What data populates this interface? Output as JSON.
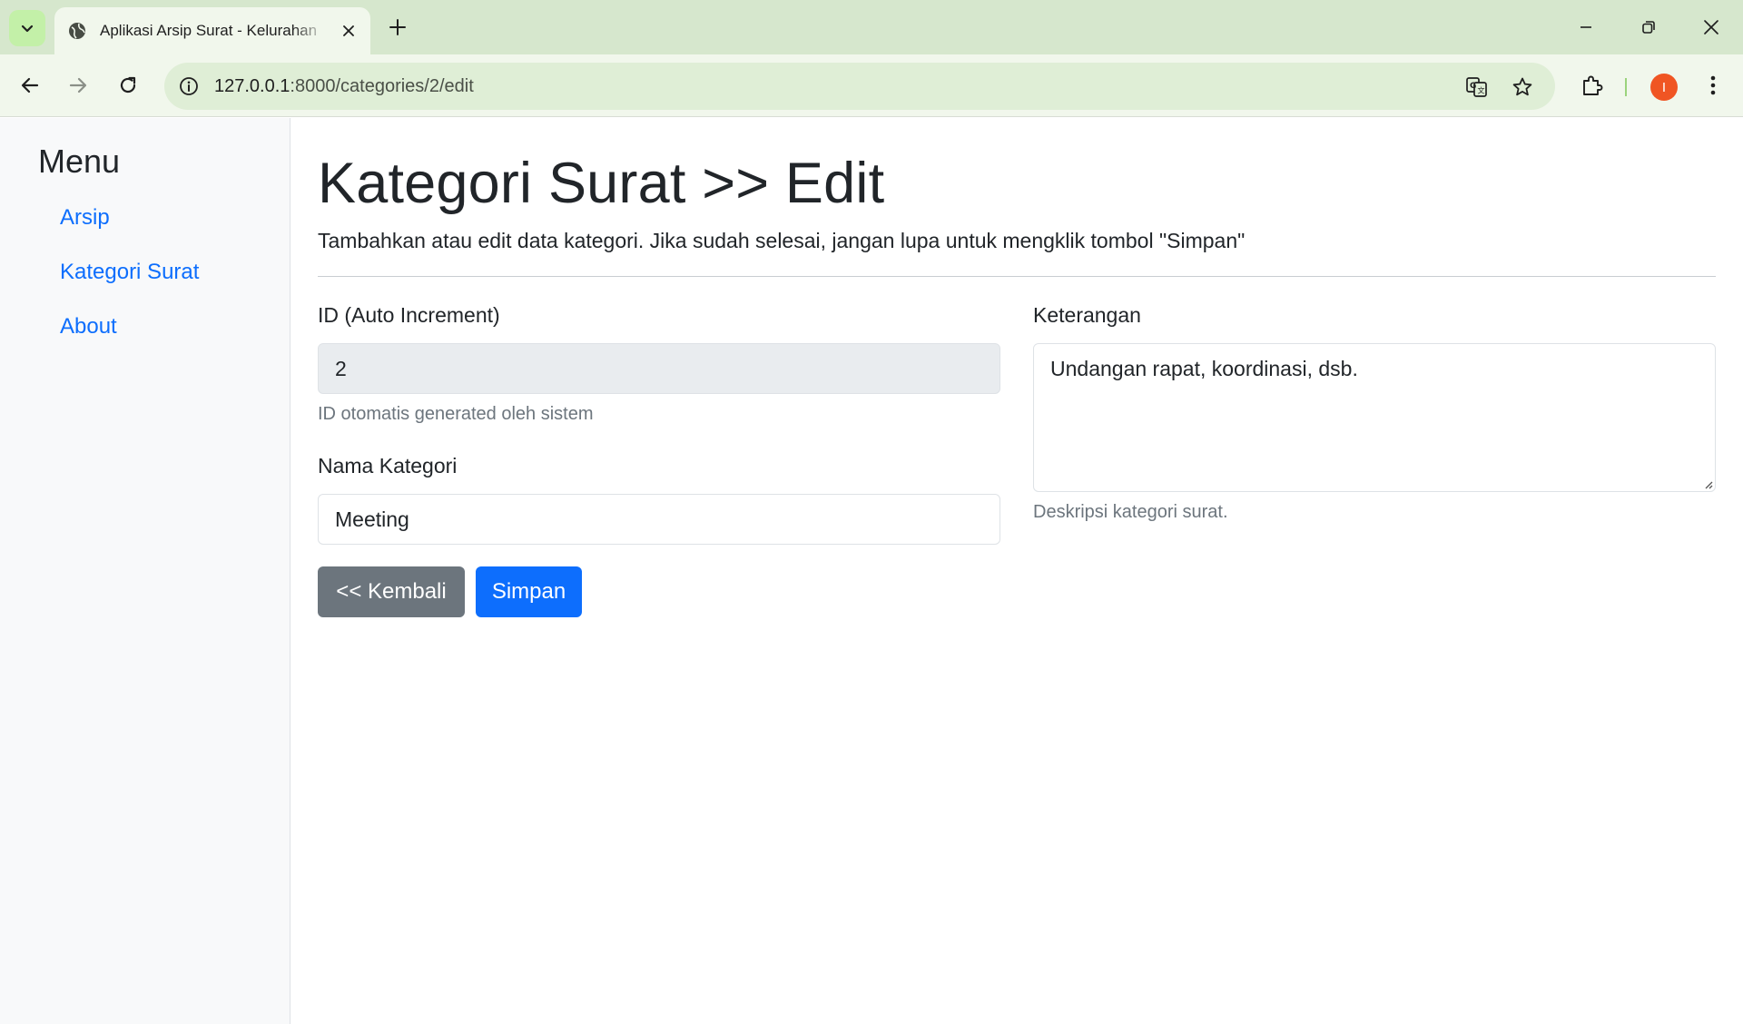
{
  "browser": {
    "tab_title": "Aplikasi Arsip Surat - Kelurahan",
    "url_host": "127.0.0.1",
    "url_path": ":8000/categories/2/edit",
    "avatar_letter": "I",
    "icons": [
      "tab-search-icon",
      "globe-icon",
      "close-icon",
      "plus-icon",
      "minimize-icon",
      "restore-icon",
      "close-window-icon",
      "back-arrow-icon",
      "forward-arrow-icon",
      "reload-icon",
      "info-icon",
      "translate-icon",
      "star-icon",
      "extensions-icon",
      "more-vert-icon"
    ],
    "colors": {
      "titlebar": "#d6e7cd",
      "toolbar": "#f1f7ec",
      "omnibox": "#dfeed6",
      "avatar": "#f05523"
    }
  },
  "sidebar": {
    "title": "Menu",
    "items": [
      {
        "label": "Arsip"
      },
      {
        "label": "Kategori Surat"
      },
      {
        "label": "About"
      }
    ]
  },
  "main": {
    "title": "Kategori Surat >> Edit",
    "lead": "Tambahkan atau edit data kategori. Jika sudah selesai, jangan lupa untuk mengklik tombol \"Simpan\"",
    "form": {
      "id_label": "ID (Auto Increment)",
      "id_value": "2",
      "id_help": "ID otomatis generated oleh sistem",
      "name_label": "Nama Kategori",
      "name_value": "Meeting",
      "desc_label": "Keterangan",
      "desc_value": "Undangan rapat, koordinasi, dsb.",
      "desc_help": "Deskripsi kategori surat."
    },
    "buttons": {
      "back": "<< Kembali",
      "save": "Simpan"
    },
    "colors": {
      "primary": "#0d6efd",
      "secondary": "#6c757d",
      "link": "#0d6efd"
    }
  }
}
